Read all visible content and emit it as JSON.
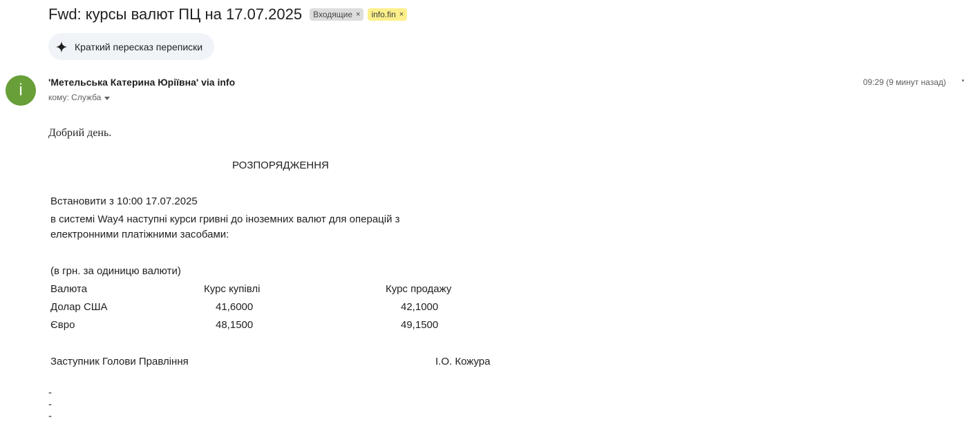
{
  "header": {
    "subject": "Fwd: курсы валют ПЦ на 17.07.2025",
    "labels": [
      {
        "text": "Входящие",
        "remove": "×",
        "color": "#dddddd"
      },
      {
        "text": "info.fin",
        "remove": "×",
        "color": "#fdf08a"
      }
    ]
  },
  "summary_button": {
    "label": "Краткий пересказ переписки",
    "icon": "sparkle-icon"
  },
  "message": {
    "avatar_letter": "i",
    "avatar_color": "#689f38",
    "sender": "'Метельська Катерина Юріївна' via info",
    "recipients": "кому: Служба",
    "timestamp": "09:29 (9 минут назад)",
    "greeting": "Добрий день.",
    "order_title": "РОЗПОРЯДЖЕННЯ",
    "line_set": "Встановити з  10:00  17.07.2025",
    "line_system": "в системі Way4 наступні курси гривні до іноземних валют для операцій з",
    "line_means": "електронними платіжними засобами:",
    "units_note": "(в грн. за одиницю валюти)",
    "table": {
      "headers": [
        "Валюта",
        "Курс купівлі",
        "Курс продажу"
      ],
      "rows": [
        [
          "Долар США",
          "41,6000",
          "42,1000"
        ],
        [
          "Євро",
          "48,1500",
          "49,1500"
        ]
      ]
    },
    "signature_role": "Заступник Голови Правління",
    "signature_name": "І.О. Кожура",
    "signature_separator": "---"
  }
}
